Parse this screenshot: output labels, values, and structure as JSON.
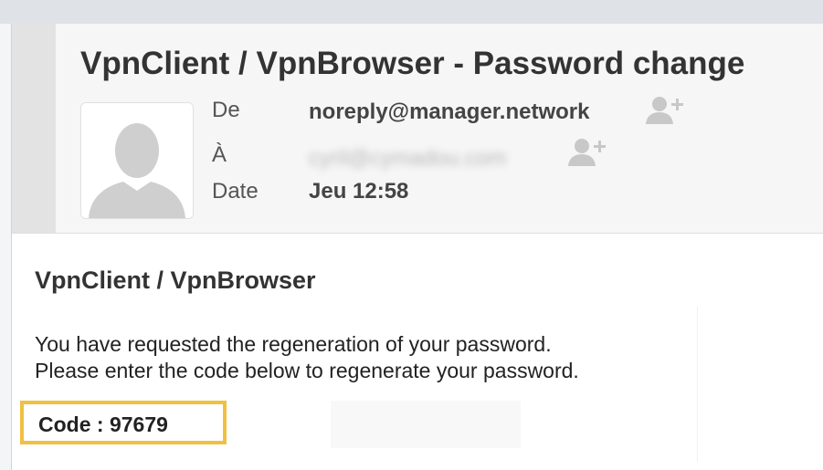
{
  "email": {
    "subject": "VpnClient / VpnBrowser - Password change",
    "from_label": "De",
    "from_value": "noreply@manager.network",
    "to_label": "À",
    "to_value": "cyril@cymadou.com",
    "date_label": "Date",
    "date_value": "Jeu 12:58"
  },
  "body": {
    "title": "VpnClient / VpnBrowser",
    "line1": "You have requested the regeneration of your password.",
    "line2": "Please enter the code below to regenerate your password.",
    "code": "Code : 97679"
  },
  "icons": {
    "avatar": "user-silhouette-icon",
    "add_contact": "add-contact-icon"
  },
  "colors": {
    "highlight": "#f0c040",
    "header_bg": "#f6f6f6"
  }
}
